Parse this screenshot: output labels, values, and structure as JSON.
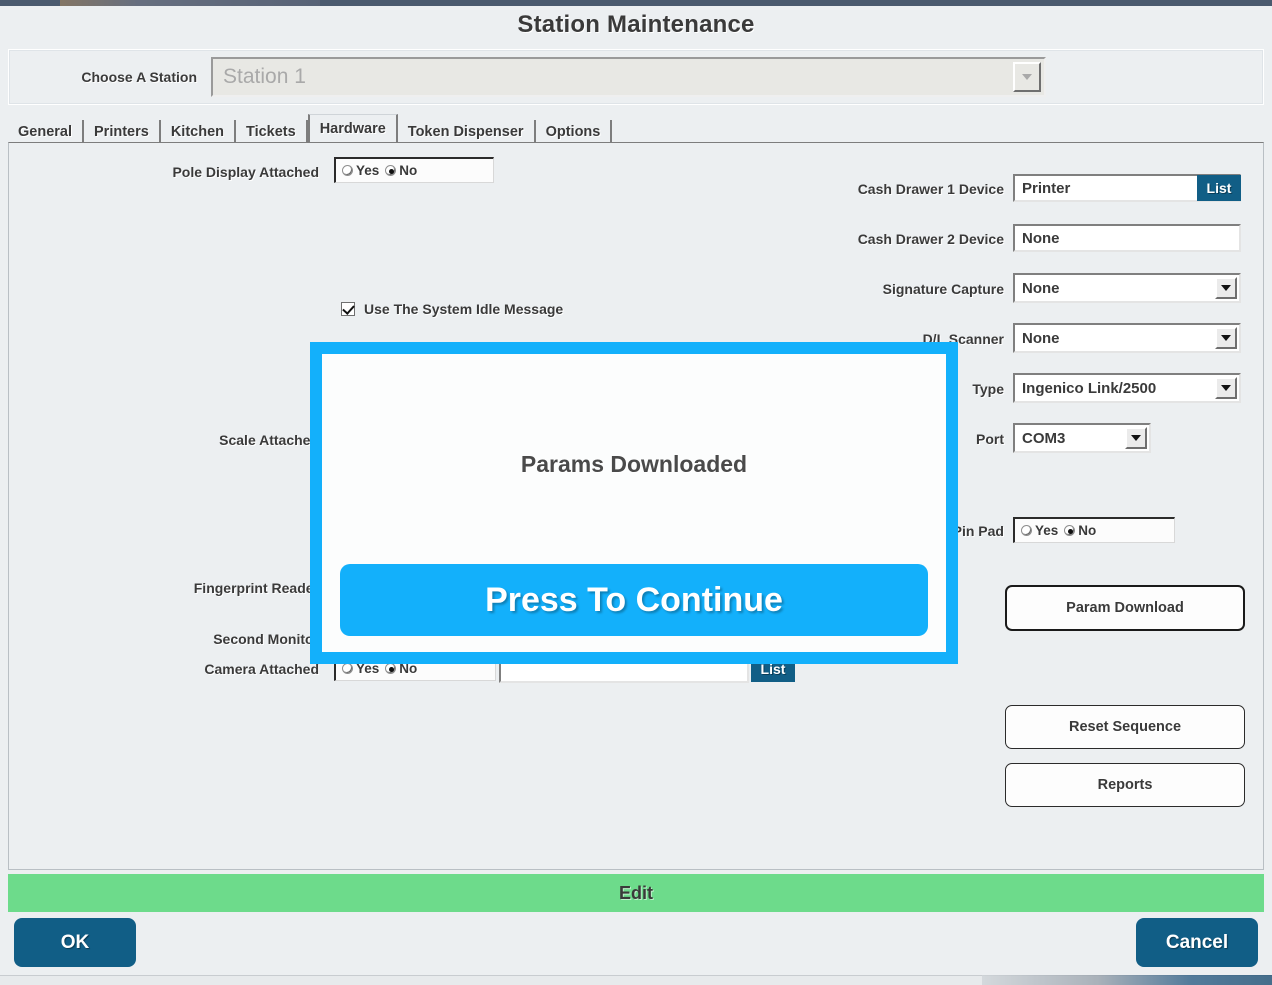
{
  "window": {
    "title": "Station Maintenance"
  },
  "station": {
    "label": "Choose A Station",
    "value": "Station 1",
    "dropdown_icon": "chevron-down-icon"
  },
  "tabs": [
    {
      "label": "General",
      "active": false
    },
    {
      "label": "Printers",
      "active": false
    },
    {
      "label": "Kitchen",
      "active": false
    },
    {
      "label": "Tickets",
      "active": false
    },
    {
      "label": "Hardware",
      "active": true
    },
    {
      "label": "Token Dispenser",
      "active": false
    },
    {
      "label": "Options",
      "active": false
    }
  ],
  "left_fields": {
    "pole_display": {
      "label": "Pole Display Attached",
      "yes_label": "Yes",
      "no_label": "No",
      "selected": "No"
    },
    "idle_message": {
      "label": "Use The System Idle Message",
      "checked": true
    },
    "scale_attached": {
      "label": "Scale Attached"
    },
    "fingerprint_reader": {
      "label": "Fingerprint Reader"
    },
    "second_monitor": {
      "label": "Second Monitor"
    },
    "camera_attached": {
      "label": "Camera Attached",
      "yes_label": "Yes",
      "no_label": "No",
      "selected": "No",
      "path_value": "",
      "list_button": "List"
    }
  },
  "right_fields": {
    "cash_drawer_1": {
      "label": "Cash Drawer 1 Device",
      "value": "Printer",
      "list_button": "List"
    },
    "cash_drawer_2": {
      "label": "Cash Drawer 2 Device",
      "value": "None"
    },
    "signature_capture": {
      "label": "Signature Capture",
      "value": "None"
    },
    "dl_scanner": {
      "label": "D/L Scanner",
      "value": "None"
    },
    "type": {
      "label": "Type",
      "value": "Ingenico Link/2500"
    },
    "port": {
      "label": "Port",
      "value": "COM3"
    },
    "pin_pad": {
      "label": "Pin Pad",
      "yes_label": "Yes",
      "no_label": "No",
      "selected": "No"
    }
  },
  "action_buttons": {
    "param_download": "Param Download",
    "reset_sequence": "Reset Sequence",
    "reports": "Reports"
  },
  "edit_band": {
    "label": "Edit",
    "color": "#6ddb8b"
  },
  "footer": {
    "ok_label": "OK",
    "cancel_label": "Cancel",
    "button_color": "#115e86"
  },
  "modal": {
    "message": "Params Downloaded",
    "button_label": "Press To Continue",
    "accent_color": "#13b0fb"
  }
}
